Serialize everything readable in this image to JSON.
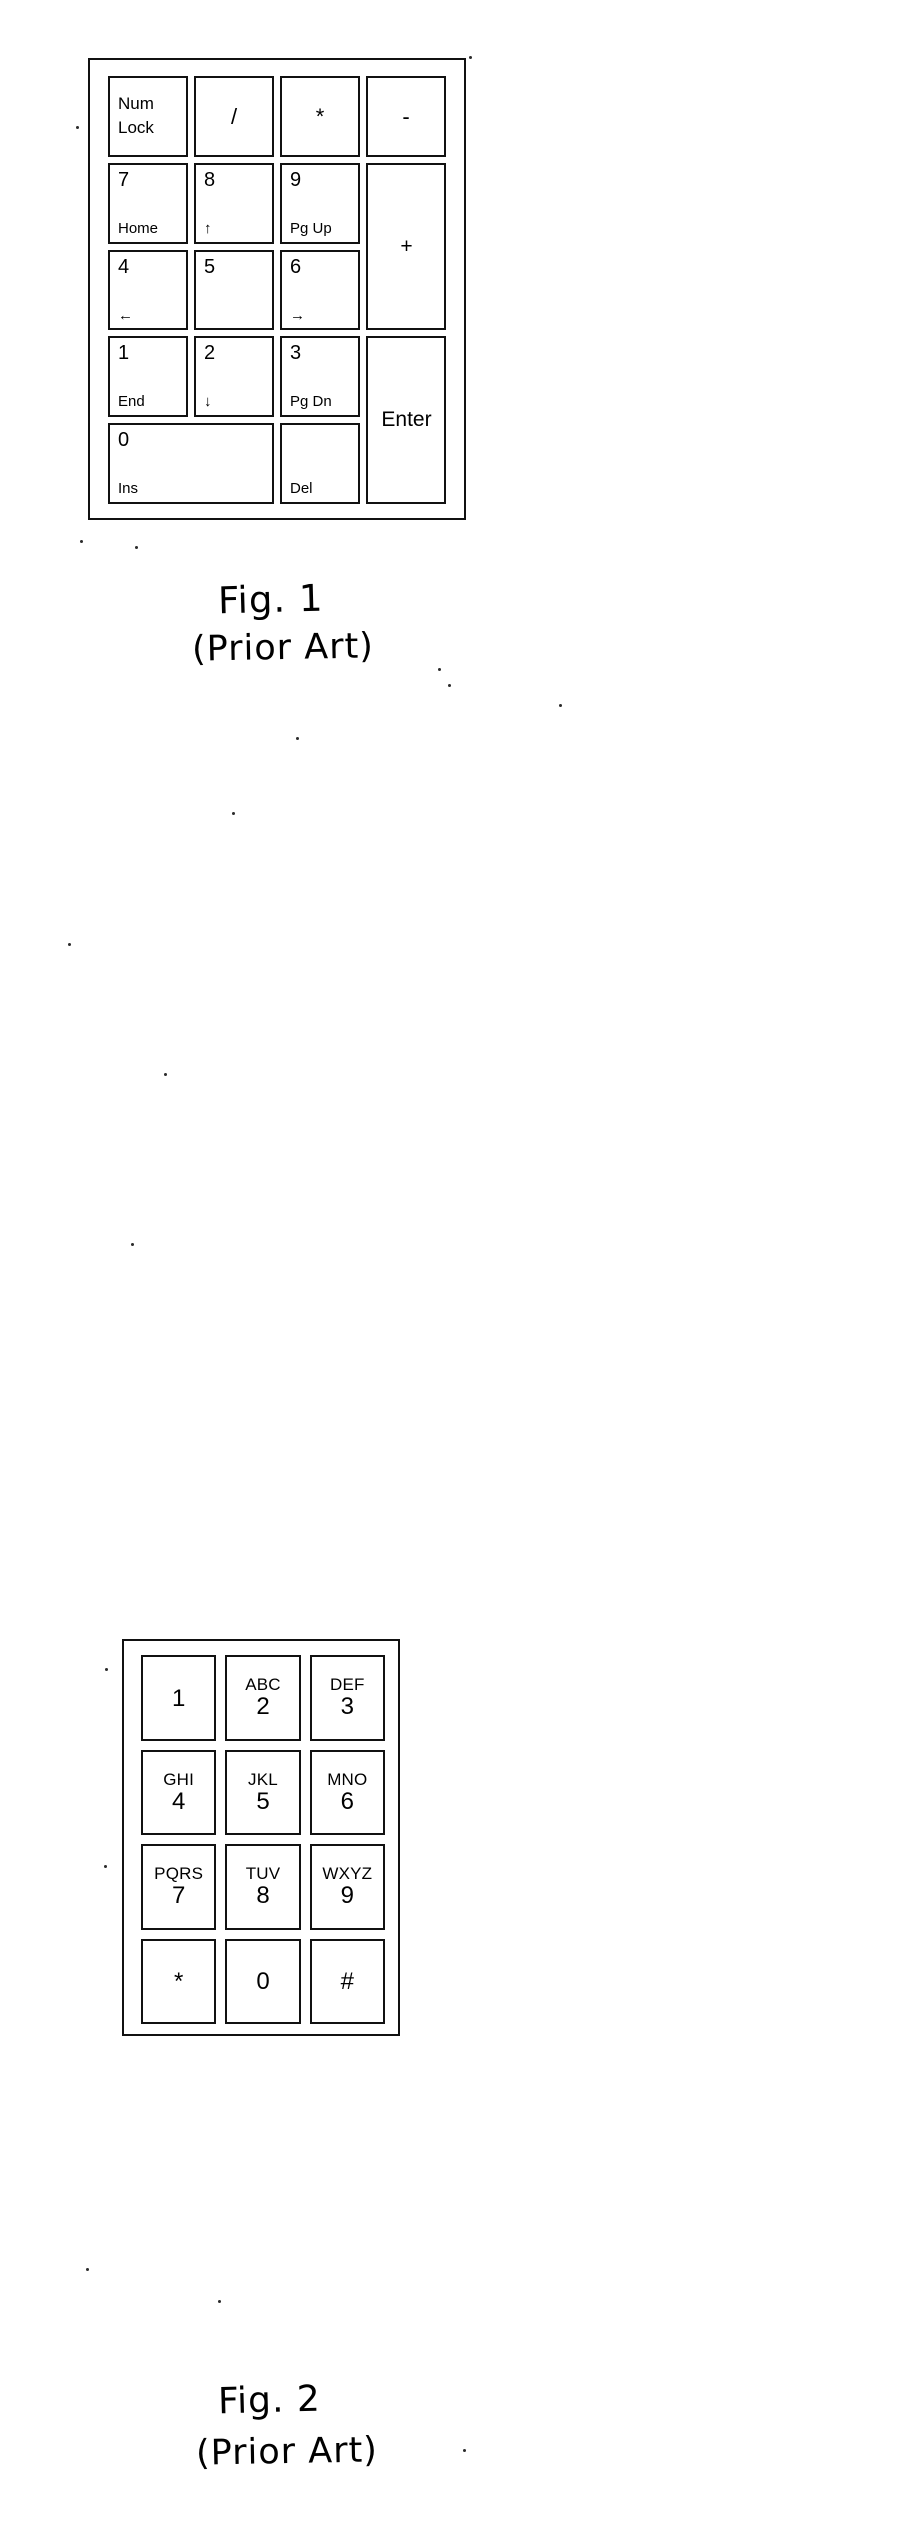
{
  "figures": [
    {
      "id": "fig-1",
      "caption_line1": "Fig. 1",
      "caption_line2": "(Prior Art)",
      "type": "numeric-keypad",
      "keys": [
        {
          "pos": "r1c1",
          "main": "Num",
          "sub": "Lock",
          "style": "twoline"
        },
        {
          "pos": "r1c2",
          "main": "/",
          "sub": "",
          "style": "center"
        },
        {
          "pos": "r1c3",
          "main": "*",
          "sub": "",
          "style": "center"
        },
        {
          "pos": "r1c4",
          "main": "-",
          "sub": "",
          "style": "center"
        },
        {
          "pos": "r2c1",
          "main": "7",
          "sub": "Home",
          "style": "split"
        },
        {
          "pos": "r2c2",
          "main": "8",
          "sub": "↑",
          "style": "split"
        },
        {
          "pos": "r2c3",
          "main": "9",
          "sub": "Pg Up",
          "style": "split"
        },
        {
          "pos": "r2c4",
          "main": "+",
          "sub": "",
          "style": "tall"
        },
        {
          "pos": "r3c1",
          "main": "4",
          "sub": "←",
          "style": "split"
        },
        {
          "pos": "r3c2",
          "main": "5",
          "sub": "",
          "style": "split"
        },
        {
          "pos": "r3c3",
          "main": "6",
          "sub": "→",
          "style": "split"
        },
        {
          "pos": "r4c1",
          "main": "1",
          "sub": "End",
          "style": "split"
        },
        {
          "pos": "r4c2",
          "main": "2",
          "sub": "↓",
          "style": "split"
        },
        {
          "pos": "r4c3",
          "main": "3",
          "sub": "Pg Dn",
          "style": "split"
        },
        {
          "pos": "r4c4",
          "main": "Enter",
          "sub": "",
          "style": "tall"
        },
        {
          "pos": "r5c1",
          "main": "0",
          "sub": "Ins",
          "style": "split-wide"
        },
        {
          "pos": "r5c3",
          "main": "",
          "sub": "Del",
          "style": "split"
        }
      ]
    },
    {
      "id": "fig-2",
      "caption_line1": "Fig. 2",
      "caption_line2": "(Prior Art)",
      "type": "telephone-keypad",
      "keys": [
        {
          "letters": "",
          "digit": "1"
        },
        {
          "letters": "ABC",
          "digit": "2"
        },
        {
          "letters": "DEF",
          "digit": "3"
        },
        {
          "letters": "GHI",
          "digit": "4"
        },
        {
          "letters": "JKL",
          "digit": "5"
        },
        {
          "letters": "MNO",
          "digit": "6"
        },
        {
          "letters": "PQRS",
          "digit": "7"
        },
        {
          "letters": "TUV",
          "digit": "8"
        },
        {
          "letters": "WXYZ",
          "digit": "9"
        },
        {
          "letters": "",
          "digit": "*"
        },
        {
          "letters": "",
          "digit": "0"
        },
        {
          "letters": "",
          "digit": "#"
        }
      ]
    }
  ],
  "colors": {
    "ink": "#111111",
    "paper": "#ffffff"
  }
}
